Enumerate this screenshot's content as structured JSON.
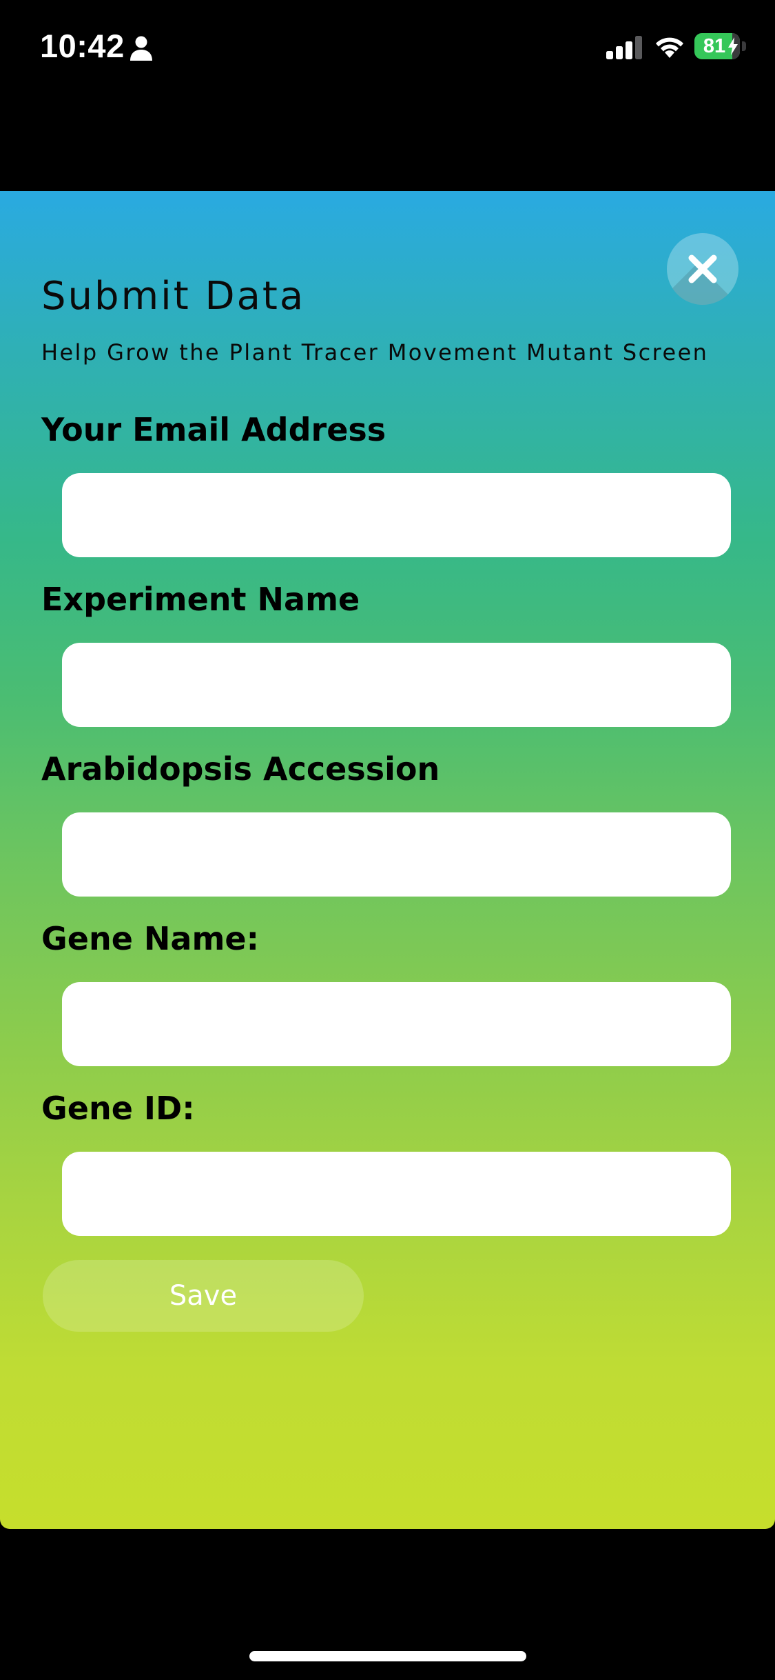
{
  "status_bar": {
    "time": "10:42",
    "battery_percent": "81",
    "icons": [
      "person-icon",
      "signal-icon",
      "wifi-icon",
      "battery-icon",
      "charging-bolt-icon"
    ]
  },
  "modal": {
    "title": "Submit Data",
    "subtitle": "Help Grow the Plant Tracer Movement Mutant Screen",
    "close_icon": "close-icon",
    "fields": [
      {
        "label": "Your Email Address",
        "value": "",
        "placeholder": ""
      },
      {
        "label": "Experiment Name",
        "value": "",
        "placeholder": ""
      },
      {
        "label": "Arabidopsis Accession",
        "value": "",
        "placeholder": ""
      },
      {
        "label": "Gene Name:",
        "value": "",
        "placeholder": ""
      },
      {
        "label": "Gene ID:",
        "value": "",
        "placeholder": ""
      }
    ],
    "save_label": "Save"
  },
  "colors": {
    "gradient_top": "#2aaae1",
    "gradient_mid": "#4bbd72",
    "gradient_bottom": "#c6de2c",
    "battery_green": "#35c759"
  }
}
